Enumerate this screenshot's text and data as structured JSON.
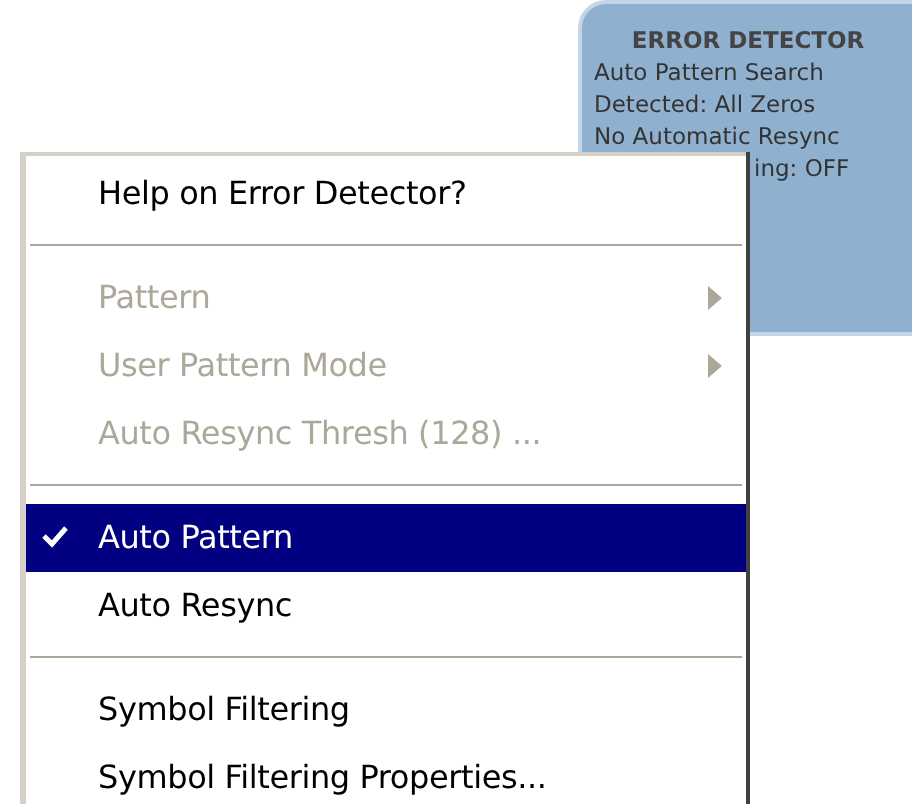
{
  "panel": {
    "title": "ERROR DETECTOR",
    "lines": [
      "Auto Pattern Search",
      "Detected: All Zeros",
      "No Automatic Resync",
      "ing: OFF"
    ]
  },
  "menu": [
    {
      "kind": "item",
      "label": "Help on Error Detector?",
      "disabled": false,
      "checked": false,
      "selected": false,
      "submenu": false
    },
    {
      "kind": "separator"
    },
    {
      "kind": "item",
      "label": "Pattern",
      "disabled": true,
      "checked": false,
      "selected": false,
      "submenu": true
    },
    {
      "kind": "item",
      "label": "User Pattern Mode",
      "disabled": true,
      "checked": false,
      "selected": false,
      "submenu": true
    },
    {
      "kind": "item",
      "label": "Auto Resync Thresh (128) ...",
      "disabled": true,
      "checked": false,
      "selected": false,
      "submenu": false
    },
    {
      "kind": "separator"
    },
    {
      "kind": "item",
      "label": "Auto Pattern",
      "disabled": false,
      "checked": true,
      "selected": true,
      "submenu": false
    },
    {
      "kind": "item",
      "label": "Auto Resync",
      "disabled": false,
      "checked": false,
      "selected": false,
      "submenu": false
    },
    {
      "kind": "separator"
    },
    {
      "kind": "item",
      "label": "Symbol Filtering",
      "disabled": false,
      "checked": false,
      "selected": false,
      "submenu": false
    },
    {
      "kind": "item",
      "label": "Symbol Filtering Properties...",
      "disabled": false,
      "checked": false,
      "selected": false,
      "submenu": false
    }
  ]
}
